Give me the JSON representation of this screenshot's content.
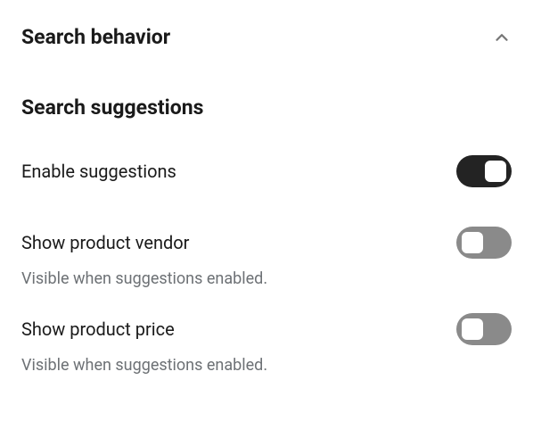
{
  "section": {
    "title": "Search behavior"
  },
  "subsection": {
    "title": "Search suggestions"
  },
  "settings": {
    "enable_suggestions": {
      "label": "Enable suggestions",
      "enabled": true
    },
    "show_vendor": {
      "label": "Show product vendor",
      "help": "Visible when suggestions enabled.",
      "enabled": false
    },
    "show_price": {
      "label": "Show product price",
      "help": "Visible when suggestions enabled.",
      "enabled": false
    }
  }
}
